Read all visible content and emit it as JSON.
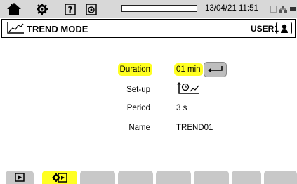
{
  "status_bar": {
    "datetime": "13/04/21 11:51",
    "icons": [
      "home-icon",
      "settings-icon",
      "help-icon",
      "snapshot-icon",
      "memory-icon",
      "network-icon",
      "battery-icon"
    ],
    "progress": 0
  },
  "title_bar": {
    "mode_icon": "trend-icon",
    "title": "TREND MODE",
    "user": "USER1",
    "user_icon": "user-icon"
  },
  "form": {
    "duration": {
      "label": "Duration",
      "value": "01 min"
    },
    "setup": {
      "label": "Set-up",
      "icon": "trend-setup-icon"
    },
    "period": {
      "label": "Period",
      "value": "3 s"
    },
    "name": {
      "label": "Name",
      "value": "TREND01"
    }
  },
  "tabs": [
    {
      "icon": "play-icon",
      "active": false
    },
    {
      "icon": "trend-config-icon",
      "active": true
    },
    {
      "icon": "",
      "active": false
    },
    {
      "icon": "",
      "active": false
    },
    {
      "icon": "",
      "active": false
    },
    {
      "icon": "",
      "active": false
    },
    {
      "icon": "",
      "active": false
    },
    {
      "icon": "",
      "active": false
    }
  ],
  "colors": {
    "highlight": "#ffff22",
    "bar_gray": "#d8d8d8",
    "tab_gray": "#c8c8c8"
  }
}
